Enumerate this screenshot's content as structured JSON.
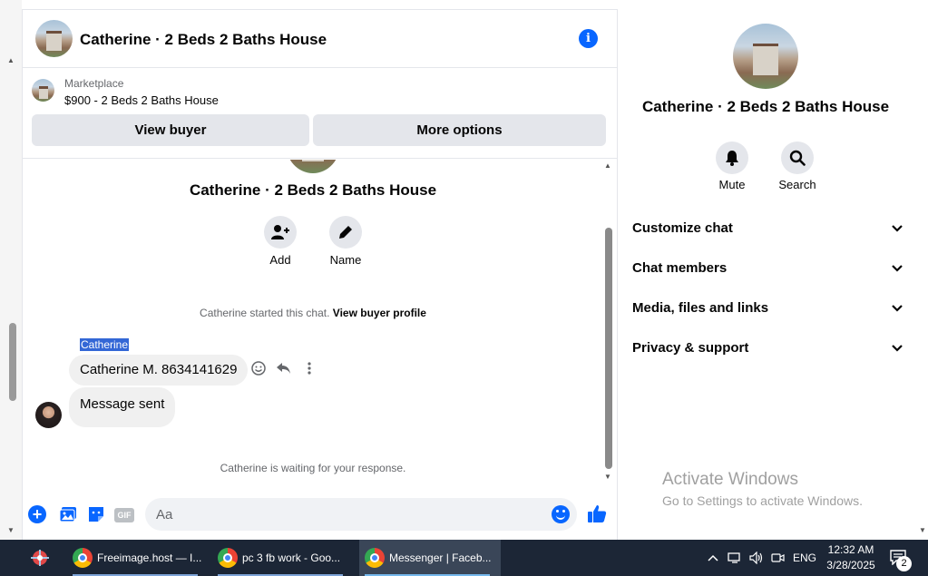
{
  "chat": {
    "header_title": "Catherine · 2 Beds 2 Baths House",
    "marketplace_label": "Marketplace",
    "listing": "$900 - 2 Beds 2 Baths House",
    "view_buyer": "View buyer",
    "more_options": "More options",
    "conversation_title": "Catherine · 2 Beds 2 Baths House",
    "add_label": "Add",
    "name_label": "Name",
    "started_text": "Catherine started this chat.",
    "view_buyer_profile": "View buyer profile",
    "sender_name": "Catherine",
    "messages": [
      {
        "text": "Catherine M. 8634141629"
      },
      {
        "text": "Message sent"
      }
    ],
    "waiting_text": "Catherine is waiting for your response.",
    "input_placeholder": "Aa"
  },
  "info_panel": {
    "title": "Catherine · 2 Beds 2 Baths House",
    "mute_label": "Mute",
    "search_label": "Search",
    "sections": [
      {
        "label": "Customize chat"
      },
      {
        "label": "Chat members"
      },
      {
        "label": "Media, files and links"
      },
      {
        "label": "Privacy & support"
      }
    ]
  },
  "watermark": {
    "line1": "Activate Windows",
    "line2": "Go to Settings to activate Windows."
  },
  "taskbar": {
    "apps": [
      {
        "label": "Freeimage.host — I..."
      },
      {
        "label": "pc 3 fb work - Goo..."
      },
      {
        "label": "Messenger | Faceb..."
      }
    ],
    "language": "ENG",
    "time": "12:32 AM",
    "date": "3/28/2025",
    "notification_count": "2"
  },
  "colors": {
    "accent": "#0866ff",
    "bubble": "#f0f0f0",
    "taskbar": "#1c2636"
  }
}
